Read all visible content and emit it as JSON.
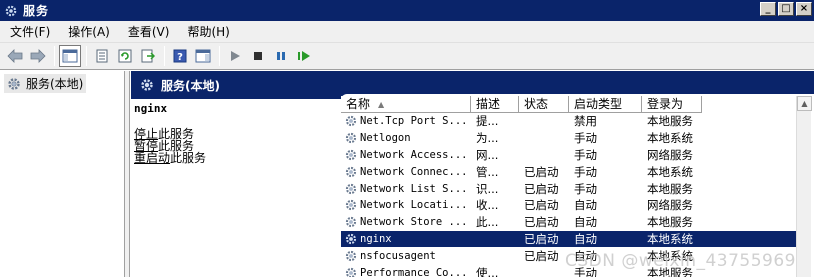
{
  "window": {
    "title": "服务"
  },
  "menu": [
    {
      "label": "文件(F)"
    },
    {
      "label": "操作(A)"
    },
    {
      "label": "查看(V)"
    },
    {
      "label": "帮助(H)"
    }
  ],
  "tree": {
    "item": "服务(本地)"
  },
  "main": {
    "header": "服务(本地)",
    "selected_service": "nginx",
    "actions": [
      {
        "link": "停止",
        "rest": "此服务"
      },
      {
        "link": "暂停",
        "rest": "此服务"
      },
      {
        "link": "重启动",
        "rest": "此服务"
      }
    ]
  },
  "list": {
    "columns": [
      "名称",
      "描述",
      "状态",
      "启动类型",
      "登录为"
    ],
    "rows": [
      {
        "name": "Net.Tcp Port S...",
        "desc": "提...",
        "status": "",
        "startup": "禁用",
        "logon": "本地服务"
      },
      {
        "name": "Netlogon",
        "desc": "为...",
        "status": "",
        "startup": "手动",
        "logon": "本地系统"
      },
      {
        "name": "Network Access...",
        "desc": "网...",
        "status": "",
        "startup": "手动",
        "logon": "网络服务"
      },
      {
        "name": "Network Connec...",
        "desc": "管...",
        "status": "已启动",
        "startup": "手动",
        "logon": "本地系统"
      },
      {
        "name": "Network List S...",
        "desc": "识...",
        "status": "已启动",
        "startup": "手动",
        "logon": "本地服务"
      },
      {
        "name": "Network Locati...",
        "desc": "收...",
        "status": "已启动",
        "startup": "自动",
        "logon": "网络服务"
      },
      {
        "name": "Network Store ...",
        "desc": "此...",
        "status": "已启动",
        "startup": "自动",
        "logon": "本地服务"
      },
      {
        "name": "nginx",
        "desc": "",
        "status": "已启动",
        "startup": "自动",
        "logon": "本地系统"
      },
      {
        "name": "nsfocusagent",
        "desc": "",
        "status": "已启动",
        "startup": "自动",
        "logon": "本地系统"
      },
      {
        "name": "Performance Co...",
        "desc": "使...",
        "status": "",
        "startup": "手动",
        "logon": "本地服务"
      }
    ],
    "selected_index": 7
  },
  "watermark": "CSDN @weixin_43755969",
  "colors": {
    "title_bar": "#0a246a",
    "selection": "#0a246a",
    "chrome": "#f0f0f0"
  }
}
